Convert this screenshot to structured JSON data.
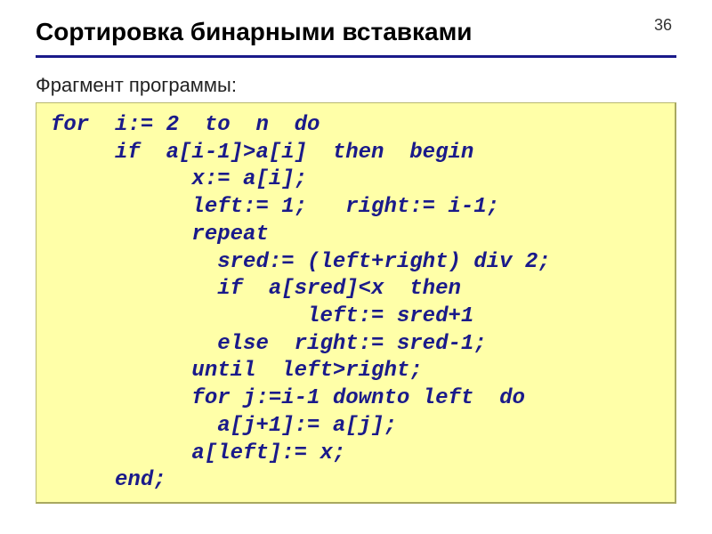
{
  "page_number": "36",
  "title": "Сортировка бинарными вставками",
  "subtitle": "Фрагмент программы:",
  "code_lines": {
    "l0": "for  i:= 2  to  n  do",
    "l1": "     if  a[i-1]>a[i]  then  begin",
    "l2": "           x:= a[i];",
    "l3": "           left:= 1;   right:= i-1;",
    "l4": "           repeat",
    "l5": "             sred:= (left+right) div 2;",
    "l6": "             if  a[sred]<x  then",
    "l7": "                    left:= sred+1",
    "l8": "             else  right:= sred-1;",
    "l9": "           until  left>right;",
    "l10": "           for j:=i-1 downto left  do",
    "l11": "             a[j+1]:= a[j];",
    "l12": "           a[left]:= x;",
    "l13": "     end;"
  }
}
